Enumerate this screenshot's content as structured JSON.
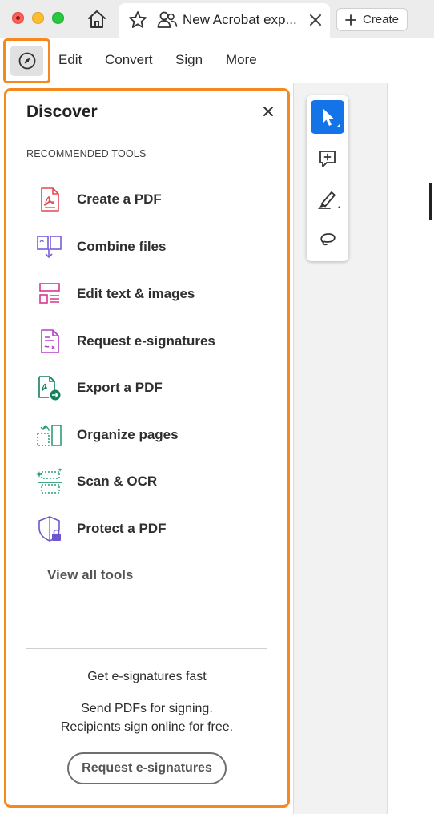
{
  "browser": {
    "tab_title": "New Acrobat exp...",
    "create_label": "Create"
  },
  "menubar": {
    "items": [
      {
        "label": "Edit"
      },
      {
        "label": "Convert"
      },
      {
        "label": "Sign"
      },
      {
        "label": "More"
      }
    ]
  },
  "discover": {
    "title": "Discover",
    "section_label": "RECOMMENDED TOOLS",
    "tools": [
      {
        "label": "Create a PDF",
        "icon": "create-pdf-icon",
        "color": "#e34850"
      },
      {
        "label": "Combine files",
        "icon": "combine-files-icon",
        "color": "#7a5dd8"
      },
      {
        "label": "Edit text & images",
        "icon": "edit-text-images-icon",
        "color": "#d83790"
      },
      {
        "label": "Request e-signatures",
        "icon": "request-esignatures-icon",
        "color": "#b440c8"
      },
      {
        "label": "Export a PDF",
        "icon": "export-pdf-icon",
        "color": "#12805c"
      },
      {
        "label": "Organize pages",
        "icon": "organize-pages-icon",
        "color": "#2d9d78"
      },
      {
        "label": "Scan & OCR",
        "icon": "scan-ocr-icon",
        "color": "#2d9d78"
      },
      {
        "label": "Protect a PDF",
        "icon": "protect-pdf-icon",
        "color": "#6e56cf"
      }
    ],
    "view_all": "View all tools",
    "promo": {
      "title": "Get e-signatures fast",
      "line1": "Send PDFs for signing.",
      "line2": "Recipients sign online for free.",
      "button": "Request e-signatures"
    }
  },
  "colors": {
    "highlight": "#f5881f",
    "accent": "#1473e6"
  }
}
